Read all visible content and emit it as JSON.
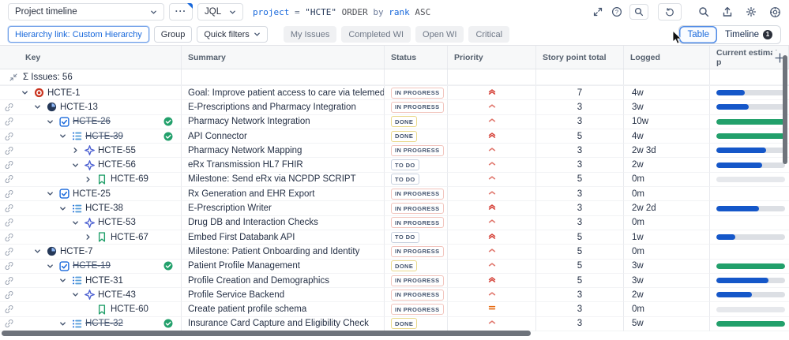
{
  "topbar": {
    "view_selector": "Project timeline",
    "more_label": "···",
    "jql_label": "JQL",
    "query_tokens": [
      {
        "text": "project",
        "type": "field"
      },
      {
        "text": " = ",
        "type": "op"
      },
      {
        "text": "\"HCTE\"",
        "type": "string"
      },
      {
        "text": " ORDER",
        "type": "kw"
      },
      {
        "text": " by",
        "type": "kw2"
      },
      {
        "text": " rank",
        "type": "field"
      },
      {
        "text": " ASC",
        "type": "plain"
      }
    ],
    "icons": [
      "expand-icon",
      "help-circle-icon",
      "search-in-query-icon",
      "refresh-icon",
      "search-icon",
      "export-icon",
      "settings-gear-icon",
      "settings-ring-icon"
    ]
  },
  "filterbar": {
    "hierarchy_button": "Hierarchy link: Custom Hierarchy",
    "group_button": "Group",
    "quick_filters_button": "Quick filters",
    "quick_chips": [
      "My Issues",
      "Completed WI",
      "Open WI",
      "Critical"
    ],
    "view_toggle": {
      "table": "Table",
      "timeline": "Timeline",
      "timeline_badge": "1"
    }
  },
  "table": {
    "columns": [
      {
        "label": "Key"
      },
      {
        "label": "Summary"
      },
      {
        "label": "Status"
      },
      {
        "label": "Priority"
      },
      {
        "label": "Story point total"
      },
      {
        "label": "Logged"
      },
      {
        "label": "Current estimate p"
      }
    ],
    "add_column_icon": "plus-icon",
    "summary_row": {
      "icon": "collapse-all-icon",
      "label": "Σ Issues: 56"
    },
    "rows": [
      {
        "key": "HCTE-1",
        "summary": "Goal: Improve patient access to care via telemedicine",
        "level": 0,
        "chevron": "down",
        "type_icon": "goal-icon",
        "link": false,
        "struck": false,
        "done": false,
        "status": "IN PROGRESS",
        "status_kind": "inprogress",
        "priority": "highest",
        "points": "7",
        "logged": "4w",
        "bar": {
          "kind": "blue",
          "pct": 41
        }
      },
      {
        "key": "HCTE-13",
        "summary": "E-Prescriptions and Pharmacy Integration",
        "level": 1,
        "chevron": "down",
        "type_icon": "initiative-icon",
        "link": true,
        "struck": false,
        "done": false,
        "status": "IN PROGRESS",
        "status_kind": "inprogress",
        "priority": "high",
        "points": "3",
        "logged": "3w",
        "bar": {
          "kind": "blue",
          "pct": 47
        }
      },
      {
        "key": "HCTE-26",
        "summary": "Pharmacy Network Integration",
        "level": 2,
        "chevron": "down",
        "type_icon": "task-icon",
        "link": true,
        "struck": true,
        "done": true,
        "status": "DONE",
        "status_kind": "done",
        "priority": "high",
        "points": "3",
        "logged": "10w",
        "bar": {
          "kind": "green",
          "pct": 100
        }
      },
      {
        "key": "HCTE-39",
        "summary": "API Connector",
        "level": 3,
        "chevron": "down",
        "type_icon": "story-list-icon",
        "link": true,
        "struck": true,
        "done": true,
        "status": "DONE",
        "status_kind": "done",
        "priority": "highest",
        "points": "5",
        "logged": "4w",
        "bar": {
          "kind": "green",
          "pct": 100
        }
      },
      {
        "key": "HCTE-55",
        "summary": "Pharmacy Network Mapping",
        "level": 4,
        "chevron": "right",
        "type_icon": "spark-icon",
        "link": true,
        "struck": false,
        "done": false,
        "status": "IN PROGRESS",
        "status_kind": "inprogress",
        "priority": "high",
        "points": "3",
        "logged": "2w 3d",
        "bar": {
          "kind": "blue",
          "pct": 72
        }
      },
      {
        "key": "HCTE-56",
        "summary": "eRx Transmission HL7 FHIR",
        "level": 4,
        "chevron": "down",
        "type_icon": "spark-icon",
        "link": true,
        "struck": false,
        "done": false,
        "status": "TO DO",
        "status_kind": "todo",
        "priority": "high",
        "points": "3",
        "logged": "2w",
        "bar": {
          "kind": "blue",
          "pct": 67
        }
      },
      {
        "key": "HCTE-69",
        "summary": "Milestone: Send eRx via NCPDP SCRIPT",
        "level": 5,
        "chevron": "right",
        "type_icon": "bookmark-icon",
        "link": true,
        "struck": false,
        "done": false,
        "status": "TO DO",
        "status_kind": "todo",
        "priority": "high",
        "points": "5",
        "logged": "0m",
        "bar": {
          "kind": "track",
          "pct": 0
        }
      },
      {
        "key": "HCTE-25",
        "summary": "Rx Generation and EHR Export",
        "level": 2,
        "chevron": "down",
        "type_icon": "task-icon",
        "link": true,
        "struck": false,
        "done": false,
        "status": "IN PROGRESS",
        "status_kind": "inprogress",
        "priority": "high",
        "points": "3",
        "logged": "0m",
        "bar": null
      },
      {
        "key": "HCTE-38",
        "summary": "E-Prescription Writer",
        "level": 3,
        "chevron": "down",
        "type_icon": "story-list-icon",
        "link": true,
        "struck": false,
        "done": false,
        "status": "IN PROGRESS",
        "status_kind": "inprogress",
        "priority": "highest",
        "points": "3",
        "logged": "2w 2d",
        "bar": {
          "kind": "blue",
          "pct": 62
        }
      },
      {
        "key": "HCTE-53",
        "summary": "Drug DB and Interaction Checks",
        "level": 4,
        "chevron": "down",
        "type_icon": "spark-icon",
        "link": true,
        "struck": false,
        "done": false,
        "status": "IN PROGRESS",
        "status_kind": "inprogress",
        "priority": "high",
        "points": "3",
        "logged": "0m",
        "bar": null
      },
      {
        "key": "HCTE-67",
        "summary": "Embed First Databank API",
        "level": 5,
        "chevron": "right",
        "type_icon": "bookmark-icon",
        "link": true,
        "struck": false,
        "done": false,
        "status": "TO DO",
        "status_kind": "todo",
        "priority": "highest",
        "points": "5",
        "logged": "1w",
        "bar": {
          "kind": "blue",
          "pct": 28
        }
      },
      {
        "key": "HCTE-7",
        "summary": "Milestone: Patient Onboarding and Identity",
        "level": 1,
        "chevron": "down",
        "type_icon": "initiative-icon",
        "link": true,
        "struck": false,
        "done": false,
        "status": "IN PROGRESS",
        "status_kind": "inprogress",
        "priority": "high",
        "points": "5",
        "logged": "0m",
        "bar": null
      },
      {
        "key": "HCTE-19",
        "summary": "Patient Profile Management",
        "level": 2,
        "chevron": "down",
        "type_icon": "task-icon",
        "link": true,
        "struck": true,
        "done": true,
        "status": "DONE",
        "status_kind": "done",
        "priority": "high",
        "points": "5",
        "logged": "3w",
        "bar": {
          "kind": "green",
          "pct": 100
        }
      },
      {
        "key": "HCTE-31",
        "summary": "Profile Creation and Demographics",
        "level": 3,
        "chevron": "down",
        "type_icon": "story-list-icon",
        "link": true,
        "struck": false,
        "done": false,
        "status": "IN PROGRESS",
        "status_kind": "inprogress",
        "priority": "highest",
        "points": "5",
        "logged": "3w",
        "bar": {
          "kind": "blue",
          "pct": 76
        }
      },
      {
        "key": "HCTE-43",
        "summary": "Profile Service Backend",
        "level": 4,
        "chevron": "down",
        "type_icon": "spark-icon",
        "link": true,
        "struck": false,
        "done": false,
        "status": "IN PROGRESS",
        "status_kind": "inprogress",
        "priority": "high",
        "points": "3",
        "logged": "2w",
        "bar": {
          "kind": "blue",
          "pct": 52
        }
      },
      {
        "key": "HCTE-60",
        "summary": "Create patient profile schema",
        "level": 5,
        "chevron": "none",
        "type_icon": "bookmark-icon",
        "link": true,
        "struck": false,
        "done": false,
        "status": "IN PROGRESS",
        "status_kind": "inprogress",
        "priority": "medium",
        "points": "3",
        "logged": "0m",
        "bar": {
          "kind": "track",
          "pct": 0
        }
      },
      {
        "key": "HCTE-32",
        "summary": "Insurance Card Capture and Eligibility Check",
        "level": 3,
        "chevron": "down",
        "type_icon": "story-list-icon",
        "link": true,
        "struck": true,
        "done": true,
        "status": "DONE",
        "status_kind": "done",
        "priority": "high",
        "points": "3",
        "logged": "5w",
        "bar": {
          "kind": "green",
          "pct": 100
        }
      }
    ]
  },
  "colors": {
    "accent_blue": "#1868DB",
    "bar_blue": "#1557C9",
    "bar_green": "#22A06B",
    "priority_red": "#D6453C",
    "priority_salmon": "#E0756B",
    "priority_orange": "#E56910",
    "done_check_green": "#22A06B",
    "track_gray": "#DCDFE4"
  }
}
